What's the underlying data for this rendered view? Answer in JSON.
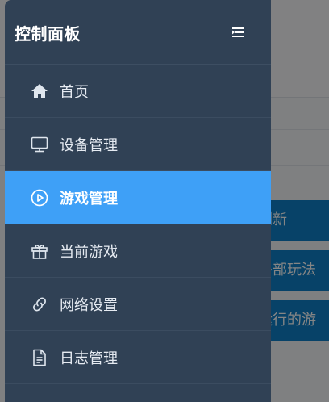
{
  "background": {
    "buttons": [
      {
        "label": "刷新"
      },
      {
        "label": "外部玩法"
      },
      {
        "label": "运行的游"
      }
    ]
  },
  "sidebar": {
    "title": "控制面板",
    "toggle_icon": "menu-fold-icon",
    "items": [
      {
        "label": "首页",
        "icon": "home-icon",
        "active": false
      },
      {
        "label": "设备管理",
        "icon": "monitor-icon",
        "active": false
      },
      {
        "label": "游戏管理",
        "icon": "play-circle-icon",
        "active": true
      },
      {
        "label": "当前游戏",
        "icon": "gift-icon",
        "active": false
      },
      {
        "label": "网络设置",
        "icon": "link-icon",
        "active": false
      },
      {
        "label": "日志管理",
        "icon": "document-icon",
        "active": false
      }
    ]
  },
  "colors": {
    "sidebar_bg": "#304155",
    "active_bg": "#3ea0f7",
    "bg_button": "#0e7fc7"
  }
}
